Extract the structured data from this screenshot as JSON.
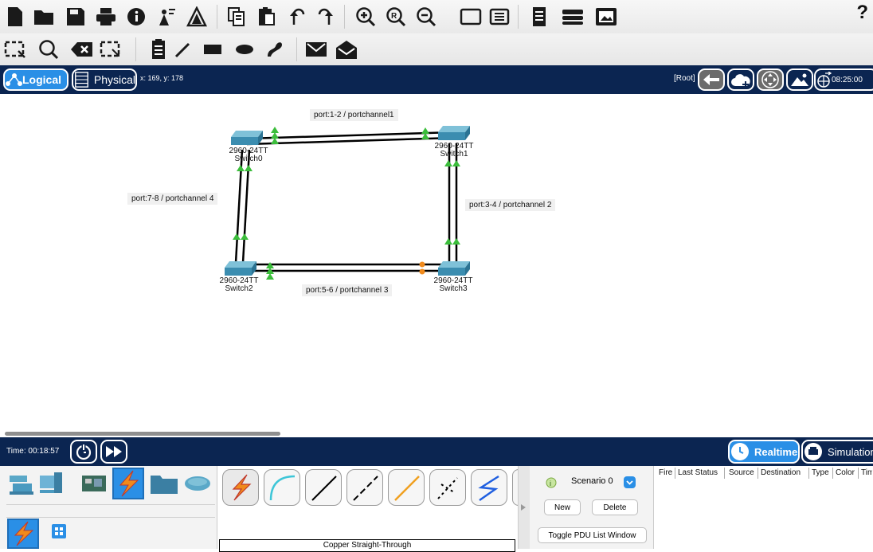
{
  "toolbar_main": {
    "icons": [
      "new-file-icon",
      "open-folder-icon",
      "save-icon",
      "print-icon",
      "info-icon",
      "activity-wizard-icon",
      "network-info-icon",
      "copy-icon",
      "paste-icon",
      "undo-icon",
      "redo-icon",
      "zoom-in-icon",
      "zoom-reset-icon",
      "zoom-out-icon",
      "drawing-palette-icon",
      "custom-device-dialog-icon",
      "notes-icon",
      "device-list-icon",
      "screenshot-icon"
    ],
    "help_label": "?"
  },
  "toolbar_tools": {
    "icons": [
      "select-icon",
      "inspect-icon",
      "delete-icon",
      "resize-shape-icon",
      "note-icon",
      "draw-line-icon",
      "draw-rectangle-icon",
      "draw-ellipse-icon",
      "draw-freeform-icon",
      "add-simple-pdu-icon",
      "add-complex-pdu-icon"
    ]
  },
  "modebar": {
    "logical_label": "Logical",
    "physical_label": "Physical",
    "coordinates": "x: 169, y: 178",
    "root_label": "[Root]",
    "clock": "08:25:00"
  },
  "topology": {
    "devices": [
      {
        "model": "2960-24TT",
        "name": "Switch0"
      },
      {
        "model": "2960-24TT",
        "name": "Switch1"
      },
      {
        "model": "2960-24TT",
        "name": "Switch2"
      },
      {
        "model": "2960-24TT",
        "name": "Switch3"
      }
    ],
    "labels": {
      "top": "port:1-2 / portchannel1",
      "right": "port:3-4 / portchannel 2",
      "bottom": "port:5-6 / portchannel 3",
      "left": "port:7-8 / portchannel 4"
    },
    "colors": {
      "link_up": "#3bbd3b",
      "link_blocking": "#f08a1c",
      "cable": "#000000"
    }
  },
  "timebar": {
    "time": "Time: 00:18:57",
    "realtime_label": "Realtime",
    "simulation_label": "Simulation"
  },
  "device_panel": {
    "categories": [
      "network-devices-icon",
      "end-devices-icon",
      "components-icon",
      "connections-icon",
      "miscellaneous-icon",
      "multiuser-icon"
    ],
    "subcategories": [
      "connections-icon",
      "automatic-grid-icon"
    ]
  },
  "cable_panel": {
    "cables": [
      "automatic-connection",
      "console",
      "copper-straight-through",
      "copper-cross-over",
      "fiber",
      "phone",
      "serial-dce"
    ],
    "selected_name": "Copper Straight-Through"
  },
  "scenario_panel": {
    "scenario": "Scenario 0",
    "new_label": "New",
    "delete_label": "Delete",
    "toggle_label": "Toggle PDU List Window"
  },
  "pdu_table": {
    "headers": [
      "Fire",
      "Last Status",
      "Source",
      "Destination",
      "Type",
      "Color",
      "Time"
    ]
  }
}
